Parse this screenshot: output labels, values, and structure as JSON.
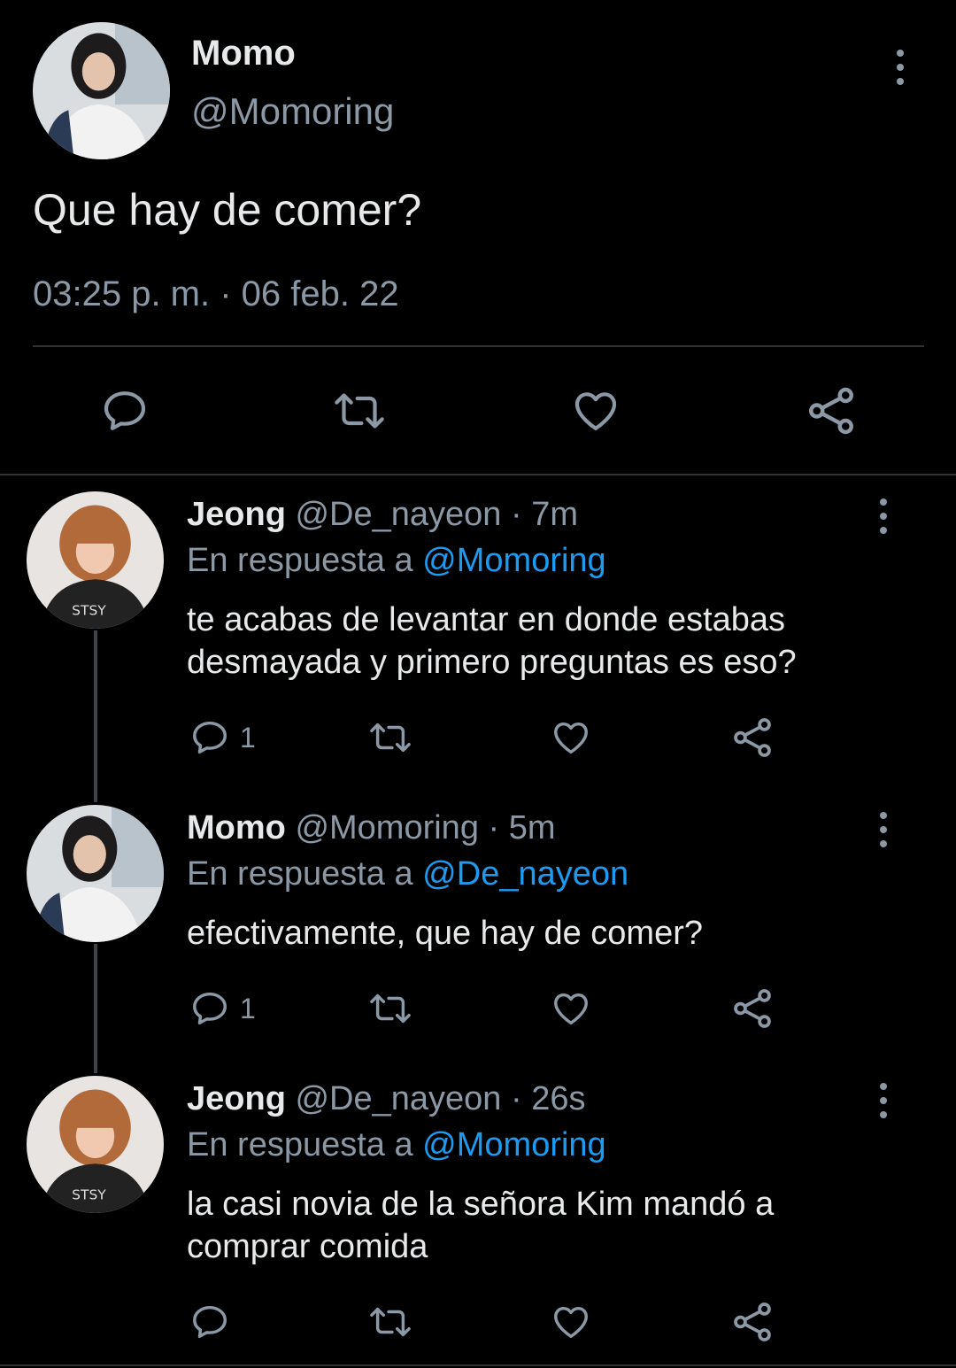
{
  "main_tweet": {
    "author_name": "Momo",
    "author_handle": "@Momoring",
    "text": "Que hay de comer?",
    "timestamp": "03:25 p. m. · 06 feb. 22",
    "actions": [
      "reply-icon",
      "retweet-icon",
      "like-icon",
      "share-icon"
    ]
  },
  "replies": [
    {
      "author_name": "Jeong",
      "author_handle": "@De_nayeon",
      "time": "· 7m",
      "reply_prefix": "En respuesta a",
      "reply_to": "@Momoring",
      "text_line1": "te acabas de levantar en donde estabas",
      "text_line2": "desmayada y primero preguntas es eso?",
      "reply_count": "1"
    },
    {
      "author_name": "Momo",
      "author_handle": "@Momoring",
      "time": "· 5m",
      "reply_prefix": "En respuesta a",
      "reply_to": "@De_nayeon",
      "text_line1": "efectivamente, que hay de comer?",
      "text_line2": "",
      "reply_count": "1"
    },
    {
      "author_name": "Jeong",
      "author_handle": "@De_nayeon",
      "time": "· 26s",
      "reply_prefix": "En respuesta a",
      "reply_to": "@Momoring",
      "text_line1": "la casi novia de la señora Kim mandó a",
      "text_line2": "comprar comida",
      "reply_count": ""
    }
  ],
  "colors": {
    "background": "#000000",
    "text": "#e7e9ea",
    "muted": "#8b98a5",
    "link": "#1d9bf0",
    "divider": "#2f3336"
  }
}
